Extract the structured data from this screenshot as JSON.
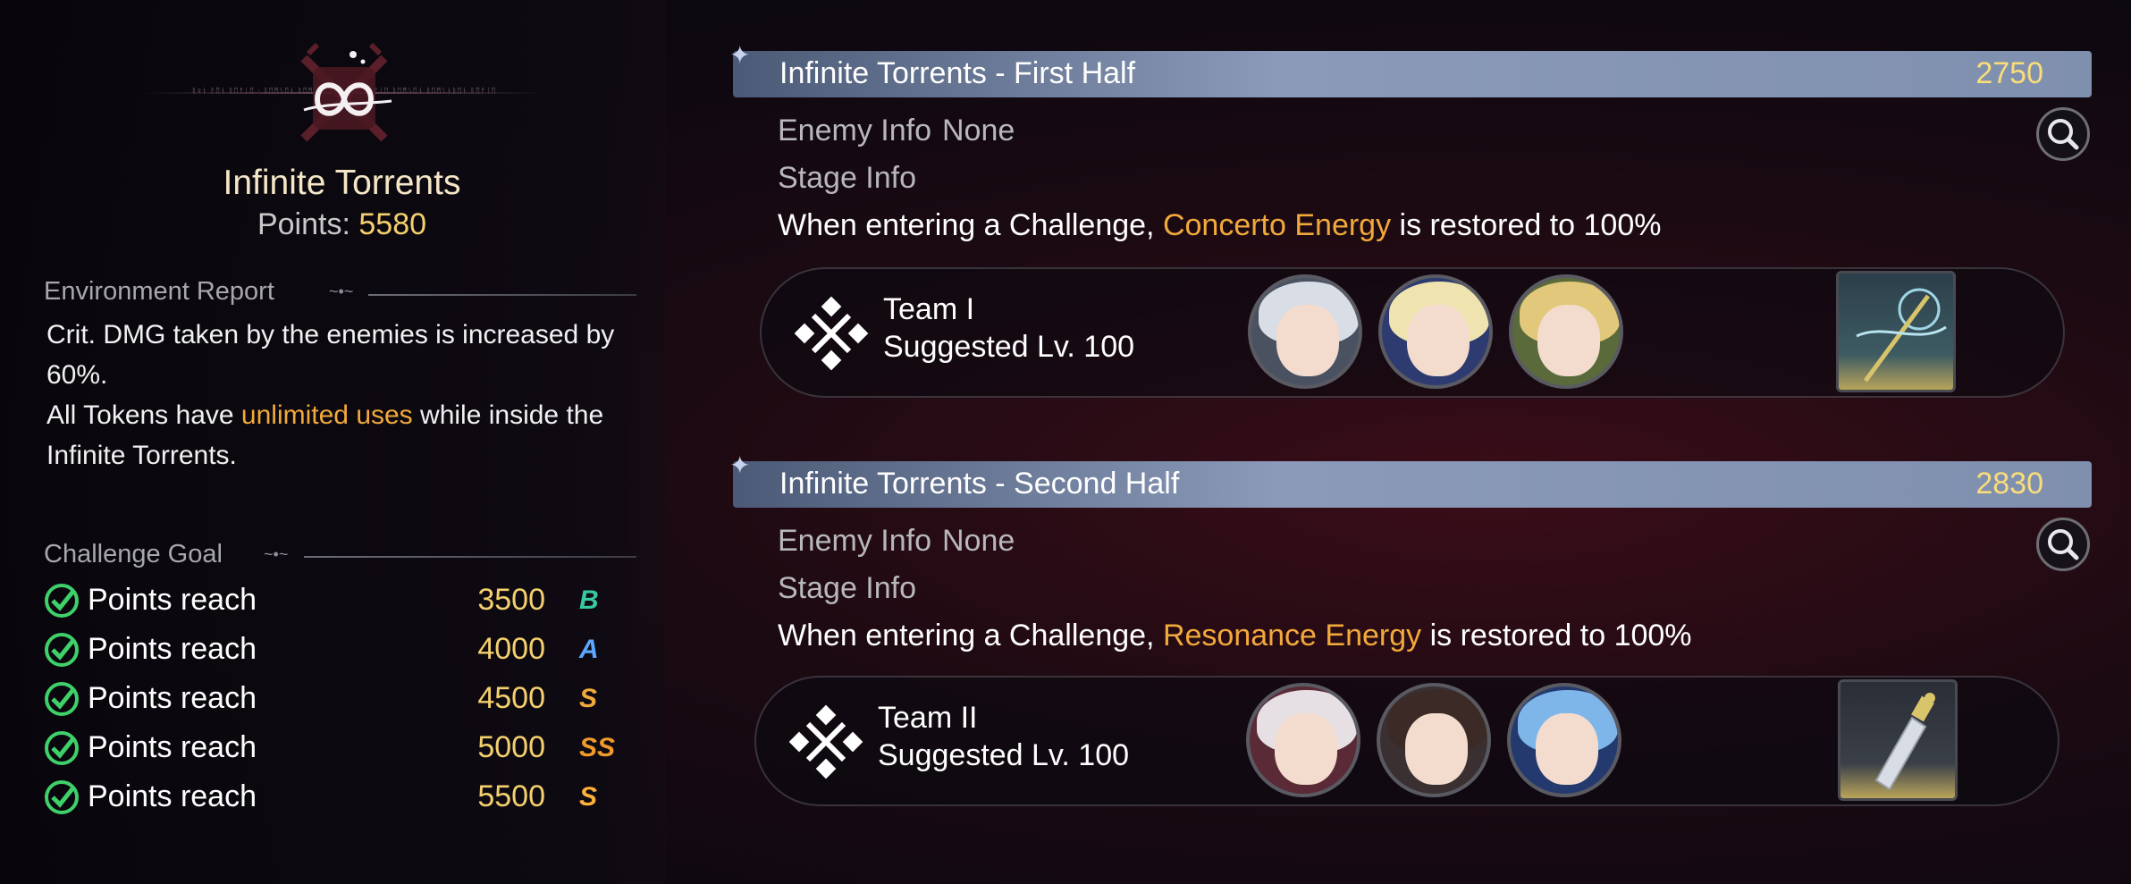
{
  "left": {
    "title": "Infinite Torrents",
    "points_label": "Points:",
    "points_value": "5580",
    "environment_label": "Environment Report",
    "env_line1": "Crit. DMG taken by the enemies is increased by 60%.",
    "env_line2_pre": "All Tokens have ",
    "env_line2_hl": "unlimited uses",
    "env_line2_post": " while inside the Infinite Torrents.",
    "challenge_label": "Challenge Goal",
    "goals": [
      {
        "text": "Points reach",
        "value": "3500",
        "rank": "B"
      },
      {
        "text": "Points reach",
        "value": "4000",
        "rank": "A"
      },
      {
        "text": "Points reach",
        "value": "4500",
        "rank": "S"
      },
      {
        "text": "Points reach",
        "value": "5000",
        "rank": "SS"
      },
      {
        "text": "Points reach",
        "value": "5500",
        "rank": "S"
      }
    ]
  },
  "stages": [
    {
      "title": "Infinite Torrents - First Half",
      "score": "2750",
      "enemy_label": "Enemy Info",
      "enemy_value": "None",
      "stage_label": "Stage Info",
      "desc_pre": "When entering a Challenge, ",
      "desc_hl": "Concerto Energy",
      "desc_post": " is restored to 100%",
      "team_name": "Team I",
      "team_level": "Suggested Lv. 100"
    },
    {
      "title": "Infinite Torrents - Second Half",
      "score": "2830",
      "enemy_label": "Enemy Info",
      "enemy_value": "None",
      "stage_label": "Stage Info",
      "desc_pre": "When entering a Challenge, ",
      "desc_hl": "Resonance Energy",
      "desc_post": " is restored to 100%",
      "team_name": "Team II",
      "team_level": "Suggested Lv. 100"
    }
  ],
  "colors": {
    "accent_gold": "#f4d06e",
    "highlight_orange": "#f2a93b",
    "banner_blue": "#7f8fae"
  },
  "icons": [
    "emblem-icon",
    "check-icon",
    "search-icon",
    "team-crossed-swords-icon",
    "echo-item-icon"
  ]
}
